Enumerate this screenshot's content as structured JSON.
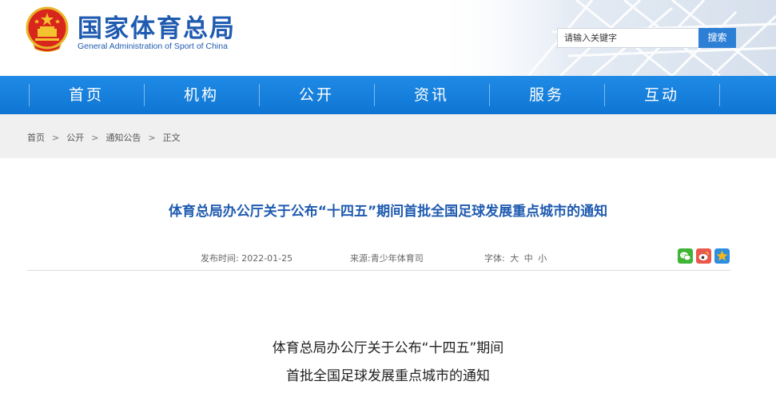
{
  "header": {
    "title": "国家体育总局",
    "subtitle": "General Administration of Sport of China",
    "search_placeholder": "请输入关键字",
    "search_button": "搜索"
  },
  "nav": {
    "items": [
      "首页",
      "机构",
      "公开",
      "资讯",
      "服务",
      "互动"
    ]
  },
  "breadcrumb": {
    "items": [
      "首页",
      "公开",
      "通知公告",
      "正文"
    ],
    "separator": ">"
  },
  "article": {
    "title": "体育总局办公厅关于公布“十四五”期间首批全国足球发展重点城市的通知",
    "publish_label": "发布时间:",
    "publish_date": "2022-01-25",
    "source_label": "来源:",
    "source": "青少年体育司",
    "font_label": "字体:",
    "font_large": "大",
    "font_medium": "中",
    "font_small": "小",
    "body_line_1": "体育总局办公厅关于公布“十四五”期间",
    "body_line_2": "首批全国足球发展重点城市的通知"
  },
  "colors": {
    "brand_blue": "#1f5bb0",
    "nav_blue": "#1a84e0",
    "search_button": "#2d7fd6",
    "wechat": "#3fb535",
    "weibo": "#e8584c",
    "qzone": "#f5b51c"
  },
  "share_icons": [
    "wechat-icon",
    "weibo-icon",
    "qzone-icon"
  ]
}
